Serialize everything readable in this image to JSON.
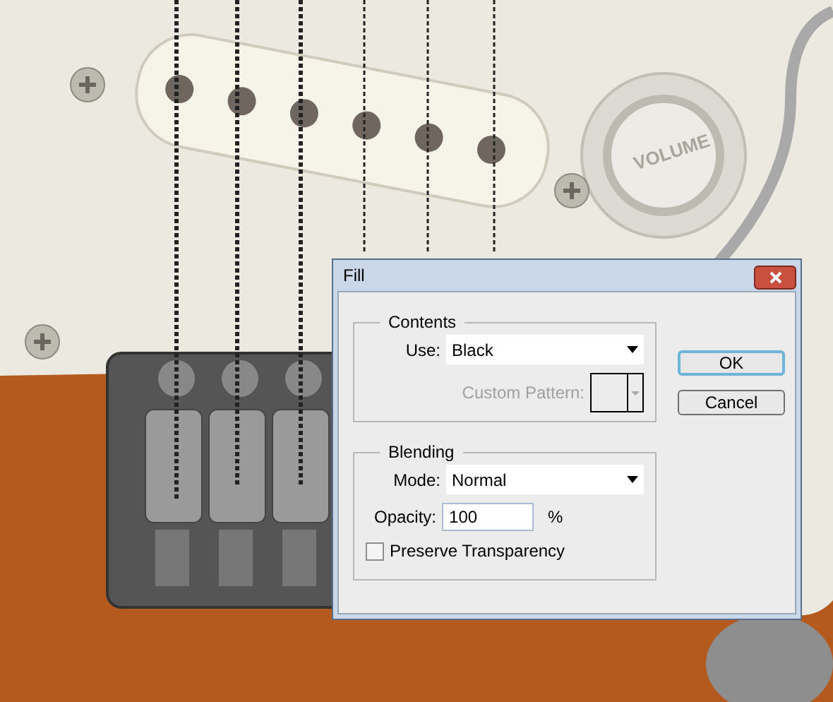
{
  "canvas": {
    "knob_label": "VOLUME"
  },
  "dialog": {
    "title": "Fill",
    "contents": {
      "legend": "Contents",
      "use": {
        "label": "Use:",
        "value": "Black"
      },
      "custom_pattern": {
        "label": "Custom Pattern:",
        "disabled": true
      }
    },
    "blending": {
      "legend": "Blending",
      "mode": {
        "label": "Mode:",
        "value": "Normal"
      },
      "opacity": {
        "label": "Opacity:",
        "value": "100",
        "unit": "%"
      },
      "preserve_transparency": {
        "label": "Preserve Transparency",
        "checked": false
      }
    },
    "buttons": [
      {
        "label": "OK",
        "default": true
      },
      {
        "label": "Cancel",
        "default": false
      }
    ]
  }
}
